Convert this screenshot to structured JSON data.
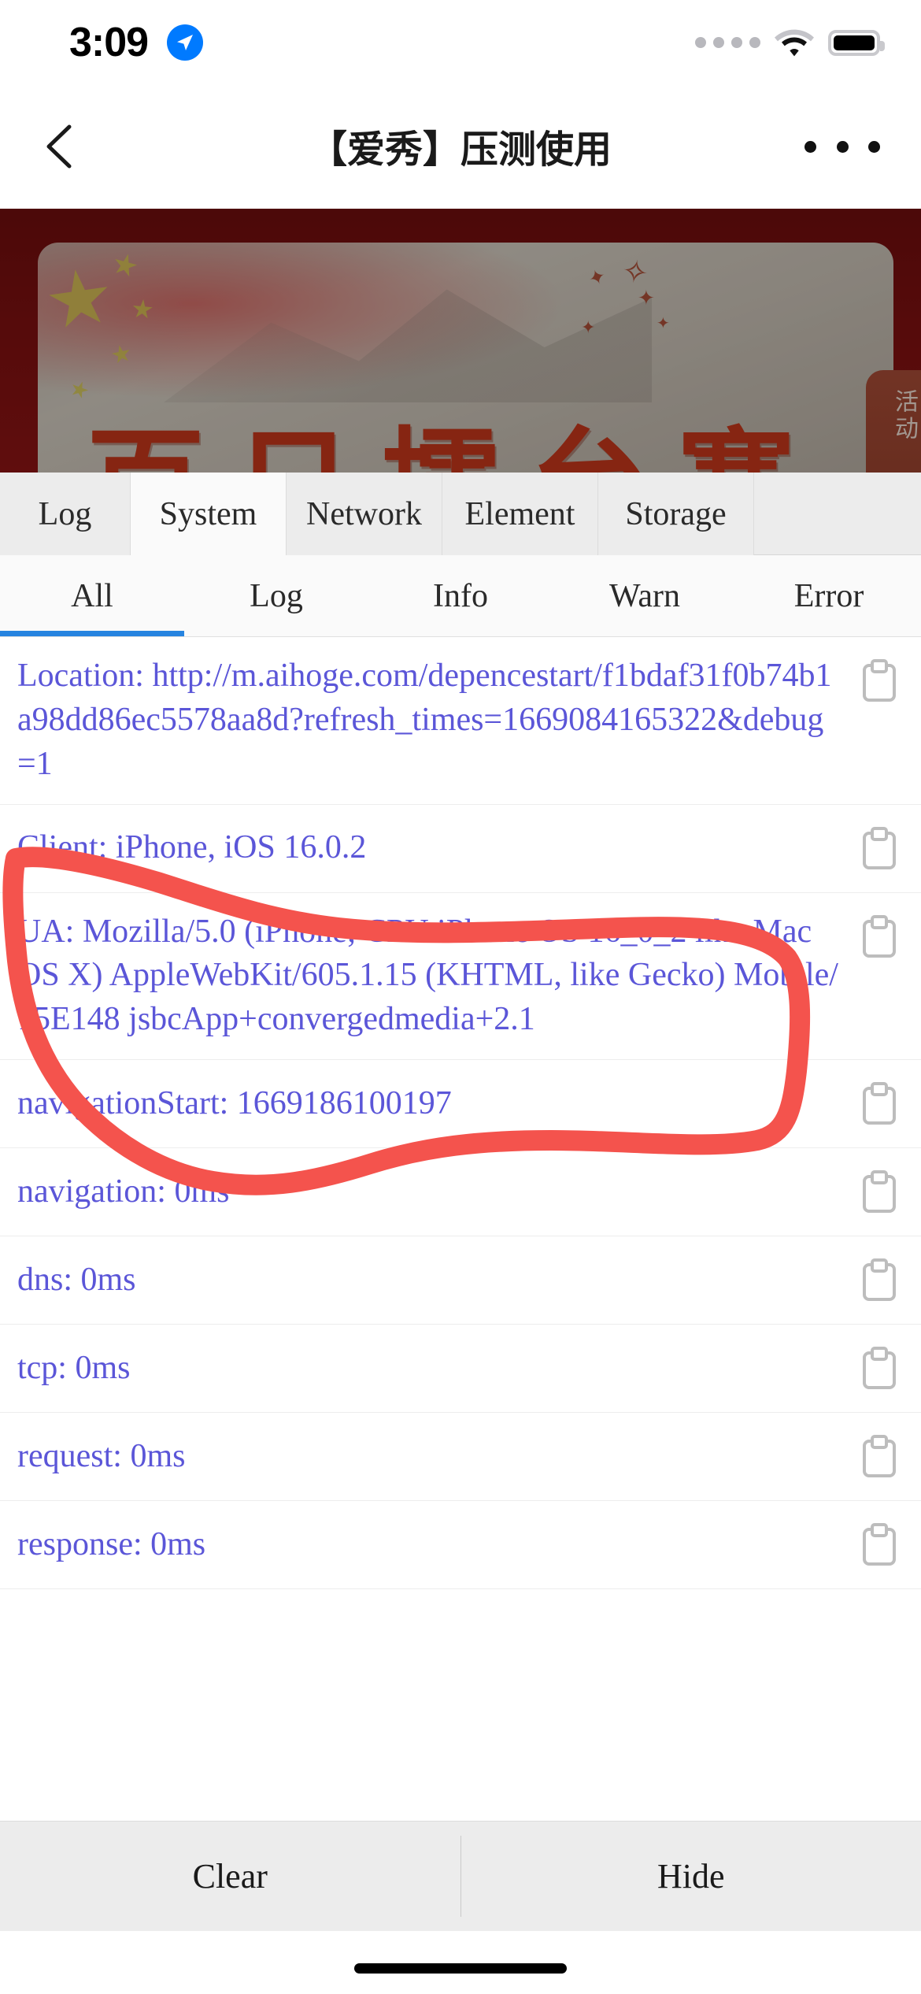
{
  "status_bar": {
    "time": "3:09",
    "location_icon": "location-arrow-icon",
    "signal_icon": "signal-dots-icon",
    "wifi_icon": "wifi-icon",
    "battery_icon": "battery-icon",
    "accent_blue": "#007aff"
  },
  "nav_bar": {
    "back_icon": "chevron-left-icon",
    "title": "【爱秀】压测使用",
    "more_icon": "more-horizontal-icon"
  },
  "web_page": {
    "banner_title": "百日擂台赛",
    "banner_chars": [
      "百",
      "日",
      "擂",
      "台",
      "赛"
    ],
    "activity_tab_label": "活动",
    "banner_bg_color": "#7a1010",
    "calligraphy_color": "#c0361a"
  },
  "vconsole": {
    "main_tabs": [
      {
        "label": "Log",
        "active": false
      },
      {
        "label": "System",
        "active": true
      },
      {
        "label": "Network",
        "active": false
      },
      {
        "label": "Element",
        "active": false
      },
      {
        "label": "Storage",
        "active": false
      }
    ],
    "filter_tabs": [
      {
        "label": "All",
        "active": true
      },
      {
        "label": "Log",
        "active": false
      },
      {
        "label": "Info",
        "active": false
      },
      {
        "label": "Warn",
        "active": false
      },
      {
        "label": "Error",
        "active": false
      }
    ],
    "active_underline_color": "#2684e0",
    "log_text_color": "#5b56d8",
    "copy_icon": "clipboard-copy-icon",
    "log_entries": [
      {
        "text": "Location: http://m.aihoge.com/depencestart/f1bdaf31f0b74b1a98dd86ec5578aa8d?refresh_times=1669084165322&debug=1"
      },
      {
        "text": "Client: iPhone, iOS 16.0.2"
      },
      {
        "text": "UA: Mozilla/5.0 (iPhone; CPU iPhone OS 16_0_2 like Mac OS X) AppleWebKit/605.1.15 (KHTML, like Gecko) Mobile/15E148 jsbcApp+convergedmedia+2.1"
      },
      {
        "text": "navigationStart: 1669186100197"
      },
      {
        "text": "navigation: 0ms"
      },
      {
        "text": "dns: 0ms"
      },
      {
        "text": "tcp: 0ms"
      },
      {
        "text": "request: 0ms"
      },
      {
        "text": "response: 0ms"
      }
    ],
    "footer": {
      "clear_label": "Clear",
      "hide_label": "Hide"
    }
  },
  "annotation": {
    "shape": "hand-drawn-red-circle",
    "color": "#f4534d",
    "target": "UA log entry"
  }
}
